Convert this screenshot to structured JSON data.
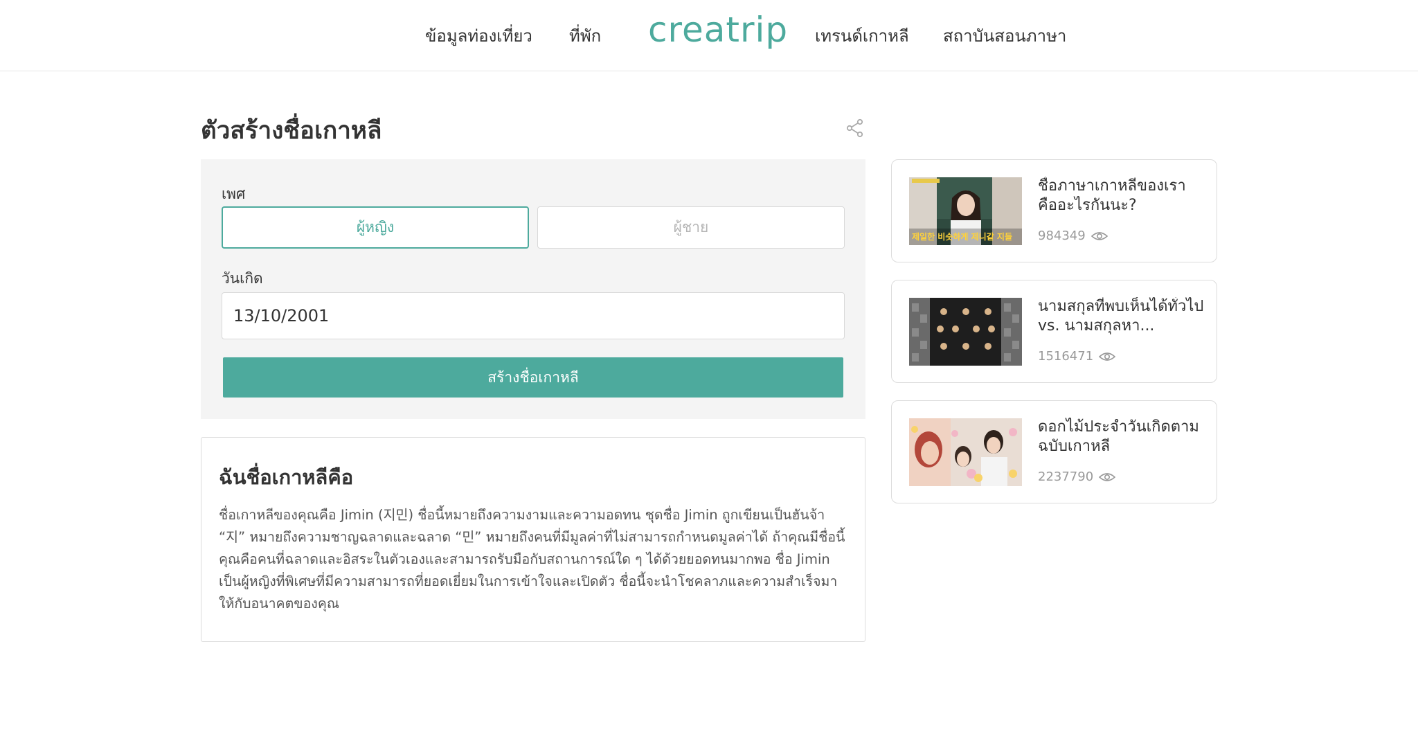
{
  "header": {
    "nav_left": [
      "ข้อมูลท่องเที่ยว",
      "ที่พัก"
    ],
    "logo": "creatrip",
    "nav_right": [
      "เทรนด์เกาหลี",
      "สถาบันสอนภาษา"
    ],
    "accent_color": "#4daa9d"
  },
  "page": {
    "title": "ตัวสร้างชื่อเกาหลี",
    "share_icon": "share-icon"
  },
  "form": {
    "gender_label": "เพศ",
    "gender_options": [
      "ผู้หญิง",
      "ผู้ชาย"
    ],
    "selected_gender": "ผู้หญิง",
    "birth_label": "วันเกิด",
    "birth_value": "13/10/2001",
    "submit_label": "สร้างชื่อเกาหลี"
  },
  "result": {
    "title": "ฉันชื่อเกาหลีคือ",
    "text": "ชื่อเกาหลีของคุณคือ Jimin (지민) ชื่อนี้หมายถึงความงามและความอดทน ชุดชื่อ Jimin ถูกเขียนเป็นฮันจ้า “지” หมายถึงความชาญฉลาดและฉลาด “민” หมายถึงคนที่มีมูลค่าที่ไม่สามารถกำหนดมูลค่าได้ ถ้าคุณมีชื่อนี้คุณคือคนที่ฉลาดและอิสระในตัวเองและสามารถรับมือกับสถานการณ์ใด ๆ ได้ด้วยยอดทนมากพอ ชื่อ Jimin เป็นผู้หญิงที่พิเศษที่มีความสามารถที่ยอดเยี่ยมในการเข้าใจและเปิดตัว ชื่อนี้จะนำโชคลาภและความสำเร็จมาให้กับอนาคตของคุณ"
  },
  "sidebar": {
    "cards": [
      {
        "title": "ชื่อภาษาเกาหลีของเราคืออะไรกันนะ?",
        "views": "984349",
        "thumb_caption": "제일한 비슷하게 제니같 지들"
      },
      {
        "title": "นามสกุลที่พบเห็นได้ทั่วไป vs. นามสกุลหา...",
        "views": "1516471"
      },
      {
        "title": "ดอกไม้ประจำวันเกิดตามฉบับเกาหลี",
        "views": "2237790"
      }
    ]
  }
}
